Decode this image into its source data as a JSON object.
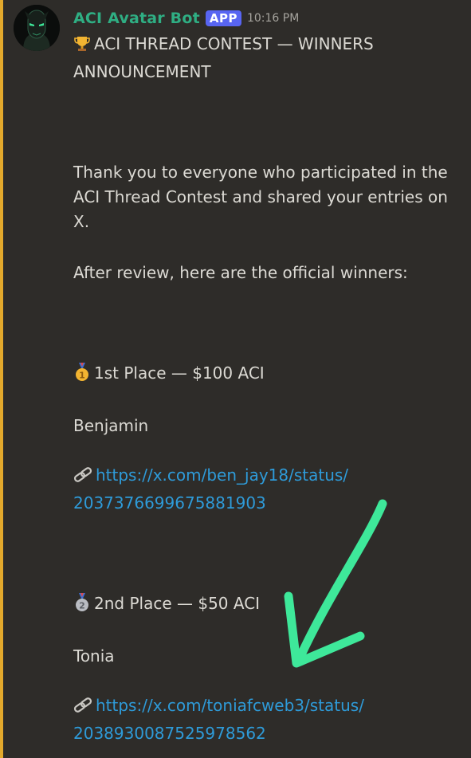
{
  "message": {
    "author": "ACI Avatar Bot",
    "badge": "APP",
    "timestamp": "10:16 PM",
    "title_line1": "ACI THREAD CONTEST — WINNERS",
    "title_line2": "ANNOUNCEMENT",
    "thanks_line1": "Thank you to everyone who participated in the",
    "thanks_line2": "ACI Thread Contest and shared your entries on",
    "thanks_line3": "X.",
    "review_line": "After review, here are the official winners:",
    "first": {
      "place": "1st Place — $100 ACI",
      "name": "Benjamin",
      "link_line1": "https://x.com/ben_jay18/status/",
      "link_line2": "2037376699675881903"
    },
    "second": {
      "place": "2nd Place — $50 ACI",
      "name": "Tonia",
      "link_line1": "https://x.com/toniafcweb3/status/",
      "link_line2": "2038930087525978562"
    }
  },
  "icons": {
    "title": "trophy-icon",
    "first": "gold-medal-icon",
    "second": "silver-medal-icon",
    "link": "link-icon"
  },
  "colors": {
    "background": "#2e2c29",
    "author": "#2fae83",
    "badge": "#5865f2",
    "link": "#2e9bd9",
    "mention_bar": "#e3a92c",
    "arrow": "#3ee89a"
  }
}
